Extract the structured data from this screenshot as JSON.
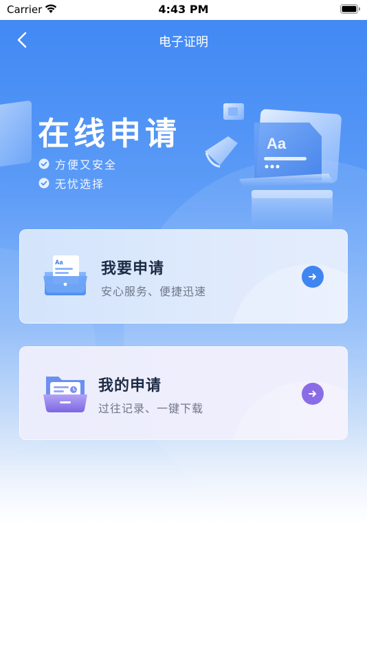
{
  "status_bar": {
    "carrier": "Carrier",
    "time": "4:43 PM"
  },
  "nav": {
    "title": "电子证明",
    "back_icon": "chevron-left-icon"
  },
  "hero": {
    "title": "在线申请",
    "features": [
      "方便又安全",
      "无忧选择"
    ]
  },
  "cards": [
    {
      "title": "我要申请",
      "subtitle": "安心服务、便捷迅速",
      "icon": "document-tray-icon",
      "arrow_color": "#3f86f0"
    },
    {
      "title": "我的申请",
      "subtitle": "过往记录、一键下载",
      "icon": "folder-tray-icon",
      "arrow_color": "#8a6de6"
    }
  ],
  "colors": {
    "primary_blue": "#3f87f3",
    "accent_purple": "#8a6de6",
    "title_text": "#1d2a44",
    "subtitle_text": "#6e7788"
  }
}
